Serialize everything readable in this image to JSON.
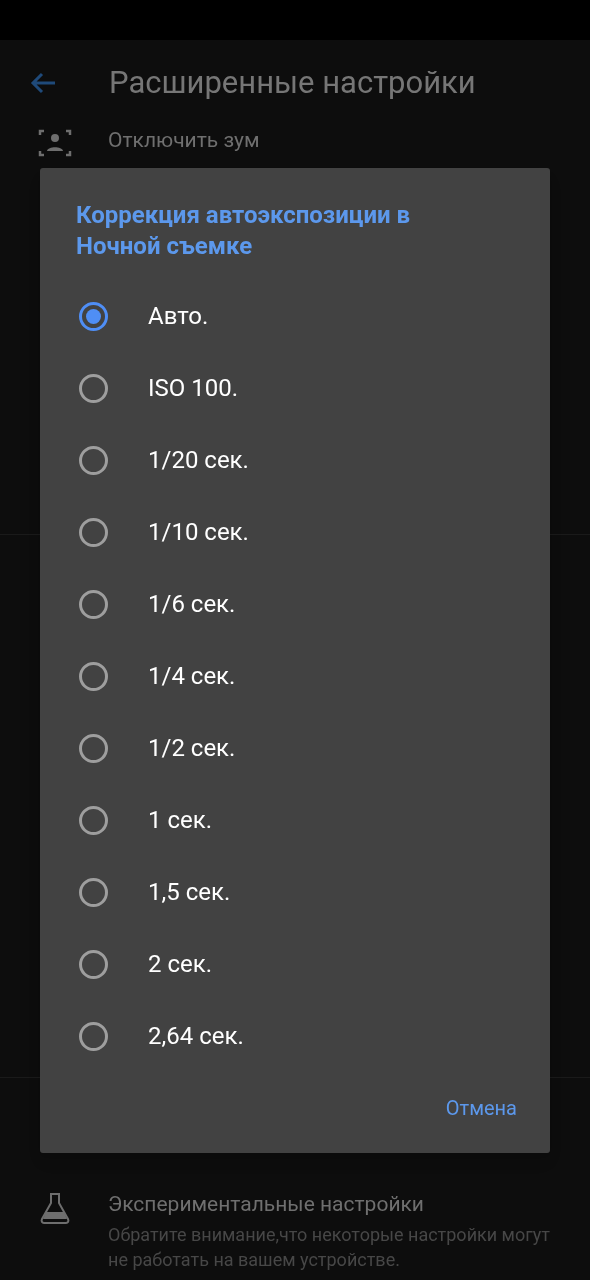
{
  "app_bar": {
    "title": "Расширенные настройки"
  },
  "settings": [
    {
      "kind": "zoom",
      "title": "Отключить зум"
    },
    {
      "kind": "experimental",
      "title": "Экспериментальные настройки",
      "subtitle": "Обратите внимание,что некоторые настройки могут не работать на вашем устройстве."
    }
  ],
  "dialog": {
    "title": "Коррекция автоэкспозиции в Ночной съемке",
    "options": [
      {
        "label": "Авто.",
        "selected": true
      },
      {
        "label": "ISO 100.",
        "selected": false
      },
      {
        "label": "1/20 сек.",
        "selected": false
      },
      {
        "label": "1/10 сек.",
        "selected": false
      },
      {
        "label": "1/6 сек.",
        "selected": false
      },
      {
        "label": "1/4 сек.",
        "selected": false
      },
      {
        "label": "1/2 сек.",
        "selected": false
      },
      {
        "label": "1 сек.",
        "selected": false
      },
      {
        "label": "1,5 сек.",
        "selected": false
      },
      {
        "label": "2 сек.",
        "selected": false
      },
      {
        "label": "2,64 сек.",
        "selected": false
      }
    ],
    "buttons": [
      "Отмена"
    ]
  }
}
